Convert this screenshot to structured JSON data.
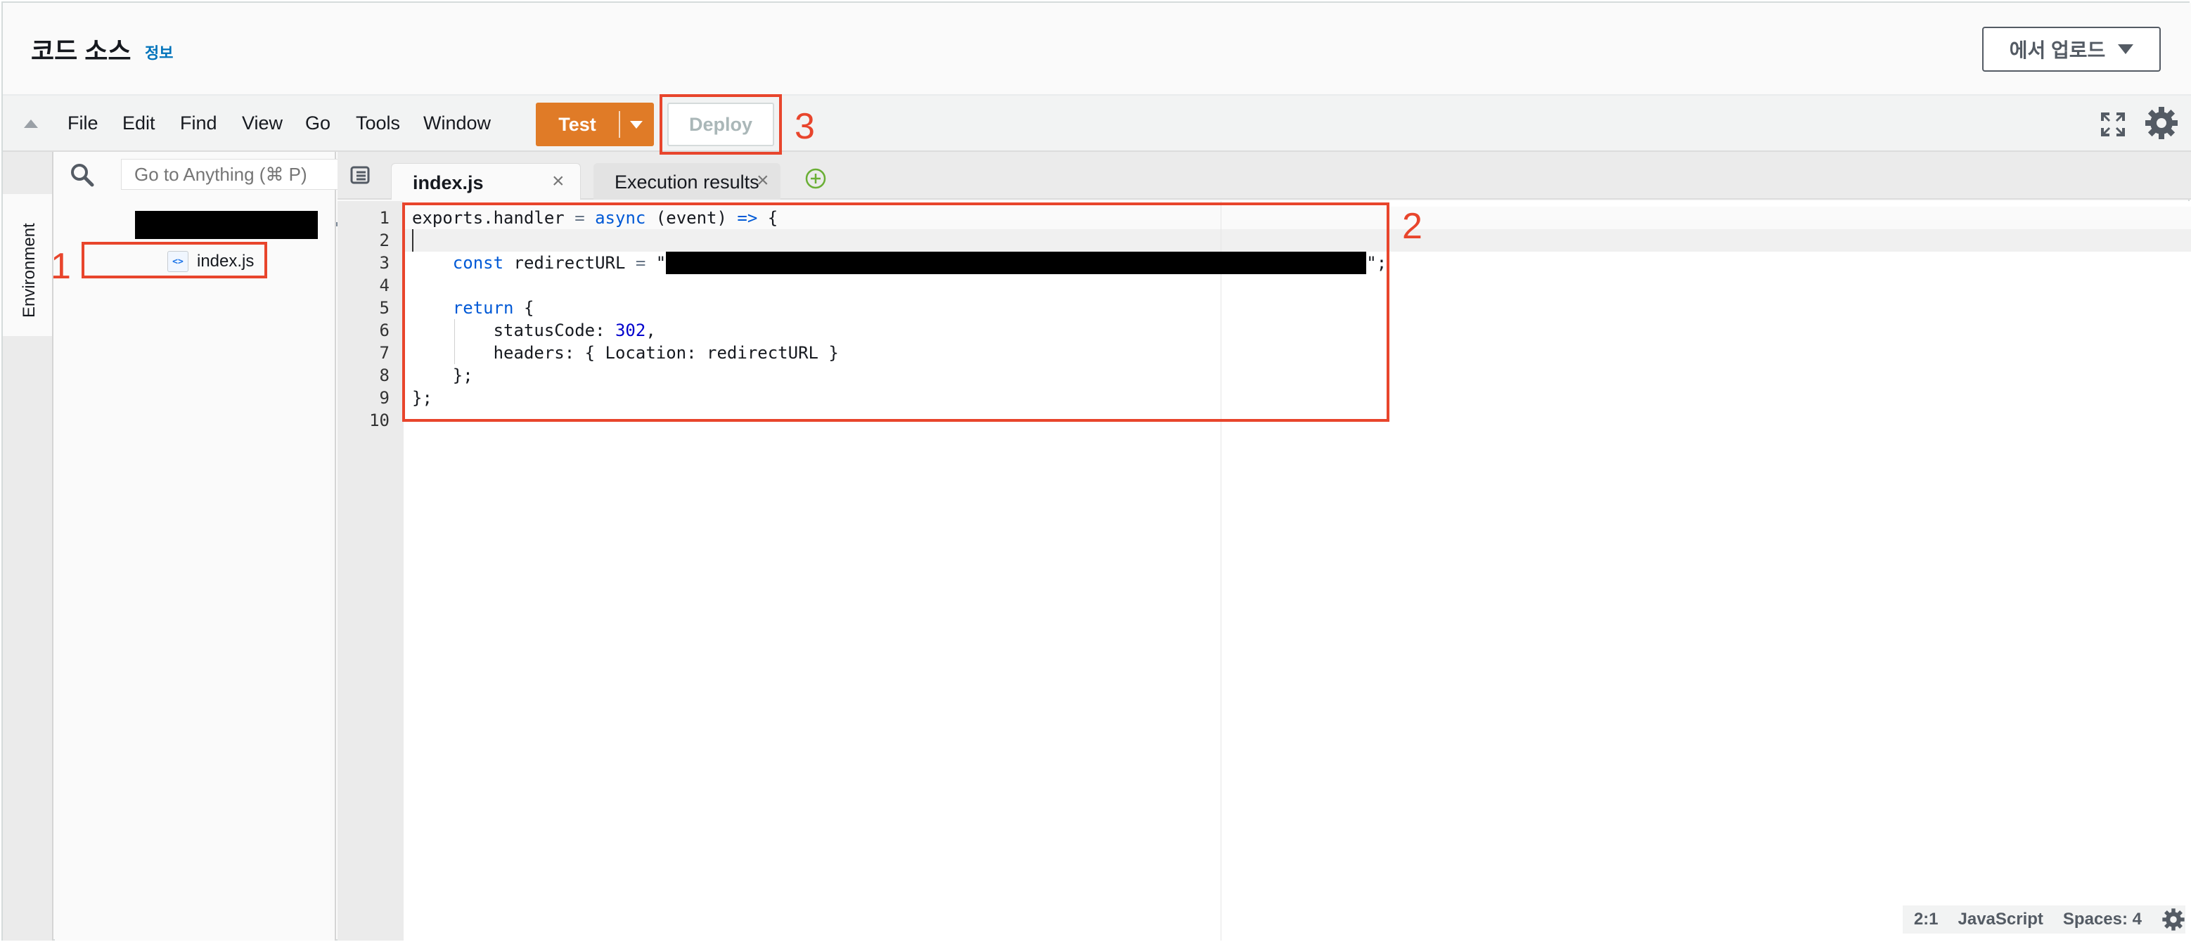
{
  "header": {
    "title": "코드 소스",
    "info_link": "정보",
    "upload_button": "에서 업로드"
  },
  "menu": {
    "items": [
      "File",
      "Edit",
      "Find",
      "View",
      "Go",
      "Tools",
      "Window"
    ],
    "test_button": "Test",
    "deploy_button": "Deploy"
  },
  "sidebar": {
    "environment_label": "Environment",
    "search_placeholder": "Go to Anything (⌘ P)",
    "file_name": "index.js"
  },
  "editor": {
    "tabs": [
      {
        "label": "index.js",
        "active": true
      },
      {
        "label": "Execution results",
        "active": false
      }
    ],
    "line_numbers": [
      "1",
      "2",
      "3",
      "4",
      "5",
      "6",
      "7",
      "8",
      "9",
      "10"
    ],
    "code": {
      "l1_a": "exports.handler ",
      "l1_eq": "=",
      "l1_async": "async",
      "l1_b": " (event) ",
      "l1_arrow": "=>",
      "l1_c": " {",
      "l3_const": "const",
      "l3_a": " redirectURL ",
      "l3_eq": "=",
      "l3_q1": " \"",
      "l3_end": "\";",
      "l5_return": "return",
      "l5_a": " {",
      "l6_a": "statusCode: ",
      "l6_num": "302",
      "l6_b": ",",
      "l7": "headers: { Location: redirectURL }",
      "l8": "};",
      "l9": "};"
    }
  },
  "status_bar": {
    "position": "2:1",
    "language": "JavaScript",
    "spaces": "Spaces: 4"
  },
  "annotations": [
    "1",
    "2",
    "3"
  ],
  "colors": {
    "accent_orange": "#e07b27",
    "annotation_red": "#e8452c",
    "keyword_blue": "#0059d6",
    "link_blue": "#0073bb"
  }
}
